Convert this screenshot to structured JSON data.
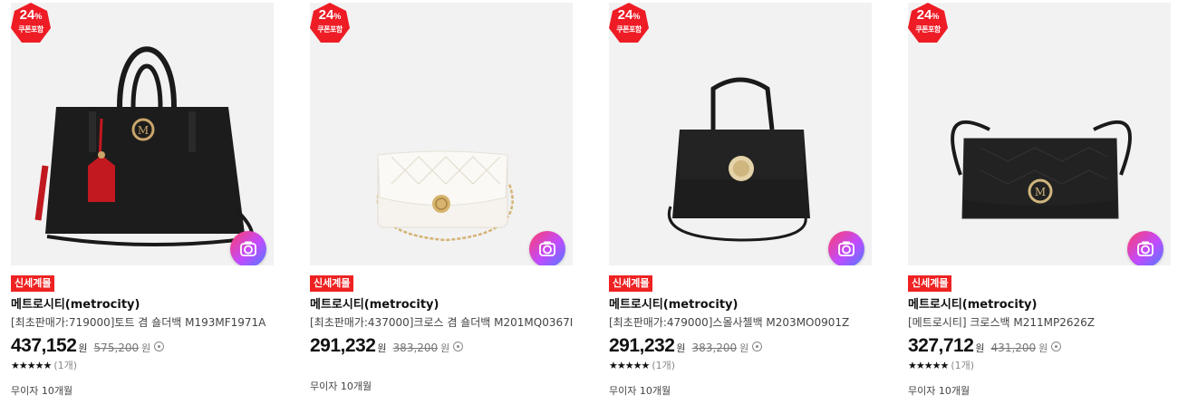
{
  "products": [
    {
      "discount": "24",
      "discount_unit": "%",
      "coupon": "쿠폰포함",
      "tag": "신세계몰",
      "brand": "메트로시티(metrocity)",
      "title": "[최초판매가:719000]토트 겸 숄더백 M193MF1971A",
      "price": "437,152",
      "price_unit": "원",
      "original_price": "575,200",
      "original_unit": "원",
      "stars": "★★★★★",
      "review_count": "(1개)",
      "installment": "무이자 10개월",
      "image": "black-tote-bag-with-red-charm"
    },
    {
      "discount": "24",
      "discount_unit": "%",
      "coupon": "쿠폰포함",
      "tag": "신세계몰",
      "brand": "메트로시티(metrocity)",
      "title": "[최초판매가:437000]크로스 겸 숄더백 M201MQ0367I",
      "price": "291,232",
      "price_unit": "원",
      "original_price": "383,200",
      "original_unit": "원",
      "stars": "",
      "review_count": "",
      "installment": "무이자 10개월",
      "image": "white-quilted-chain-bag"
    },
    {
      "discount": "24",
      "discount_unit": "%",
      "coupon": "쿠폰포함",
      "tag": "신세계몰",
      "brand": "메트로시티(metrocity)",
      "title": "[최초판매가:479000]스몰사첼백 M203MO0901Z",
      "price": "291,232",
      "price_unit": "원",
      "original_price": "383,200",
      "original_unit": "원",
      "stars": "★★★★★",
      "review_count": "(1개)",
      "installment": "무이자 10개월",
      "image": "black-small-satchel"
    },
    {
      "discount": "24",
      "discount_unit": "%",
      "coupon": "쿠폰포함",
      "tag": "신세계몰",
      "brand": "메트로시티(metrocity)",
      "title": "[메트로시티] 크로스백 M211MP2626Z",
      "price": "327,712",
      "price_unit": "원",
      "original_price": "431,200",
      "original_unit": "원",
      "stars": "★★★★★",
      "review_count": "(1개)",
      "installment": "무이자 10개월",
      "image": "black-chevron-crossbody"
    }
  ],
  "colors": {
    "badge_red": "#ee1c25",
    "tag_red": "#ee2222",
    "camera_gradient": [
      "#ff3d6a",
      "#c04bff",
      "#4c7dff"
    ],
    "thumb_bg": "#f2f2f2"
  },
  "icons": [
    "discount-badge-icon",
    "camera-search-icon",
    "info-circle-icon",
    "star-icon"
  ]
}
